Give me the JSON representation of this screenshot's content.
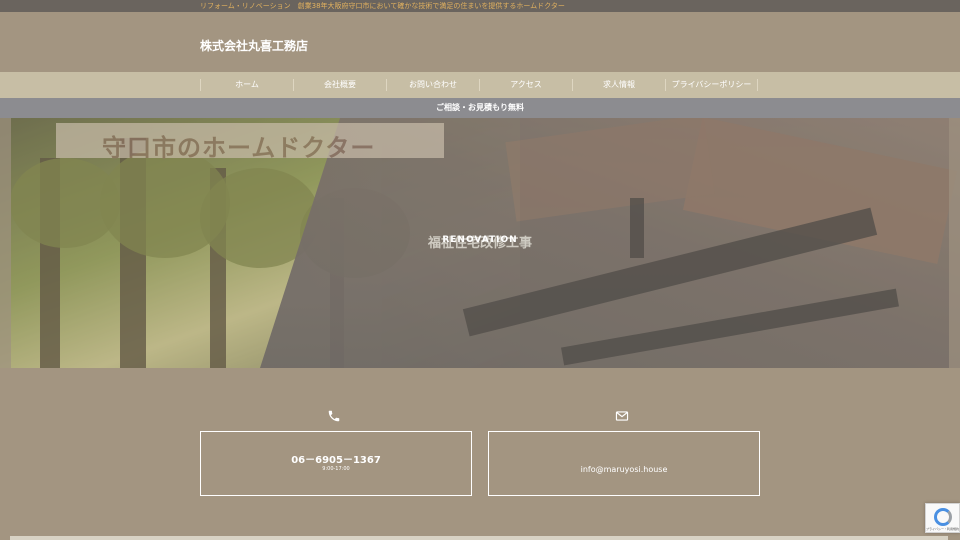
{
  "topbar": {
    "tagline": "リフォーム・リノベーション　創業38年大阪府守口市において確かな技術で満足の住まいを提供するホームドクター"
  },
  "header": {
    "site_title": "株式会社丸喜工務店"
  },
  "nav": {
    "items": [
      {
        "label": "ホーム"
      },
      {
        "label": "会社概要"
      },
      {
        "label": "お問い合わせ"
      },
      {
        "label": "アクセス"
      },
      {
        "label": "求人情報"
      },
      {
        "label": "プライバシーポリシー"
      }
    ]
  },
  "notice": {
    "text": "ご相談・お見積もり無料"
  },
  "hero": {
    "banner_text": "守口市のホームドクター",
    "caption_primary": "福祉住宅改修工事",
    "caption_secondary": "RENOVATION"
  },
  "contact": {
    "phone": {
      "icon": "phone-icon",
      "number": "06－6905－1367",
      "hours": "9:00-17:00"
    },
    "email": {
      "icon": "envelope-icon",
      "address": "info@maruyosi.house"
    }
  },
  "recaptcha": {
    "icon": "recaptcha-icon",
    "terms": "プライバシー・利用規約"
  },
  "colors": {
    "background": "#a39581",
    "topbar": "#6a645e",
    "tagline": "#e1b15f",
    "nav": "#c7bea5",
    "notice": "#8c8c90",
    "text": "#ffffff"
  }
}
